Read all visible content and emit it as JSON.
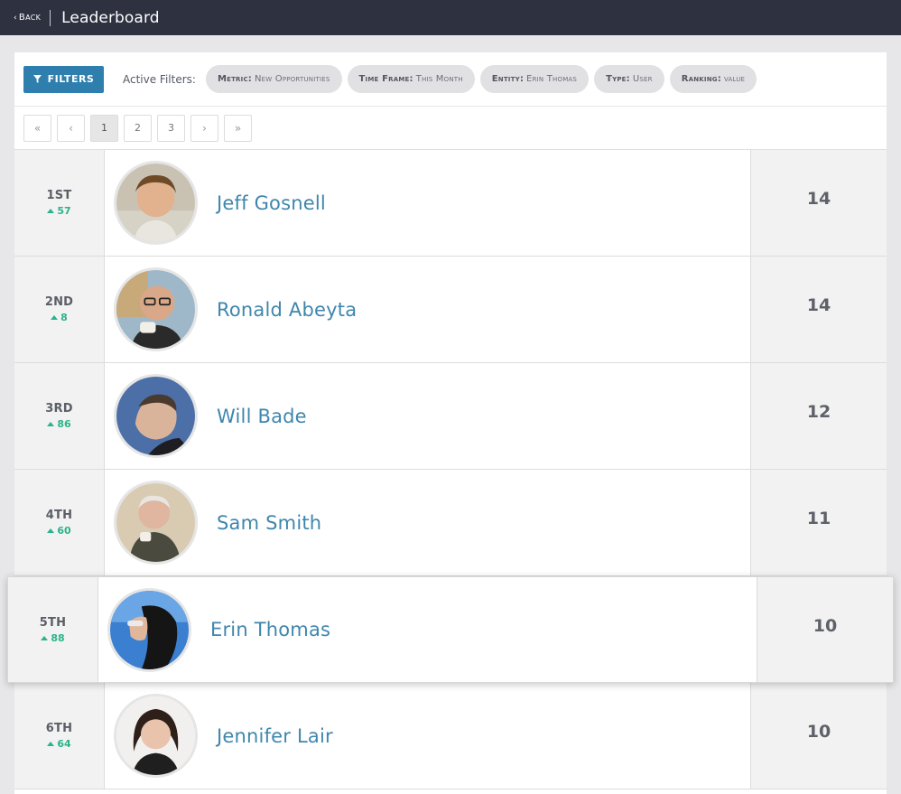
{
  "header": {
    "back_label": "Back",
    "title": "Leaderboard"
  },
  "filters": {
    "button_label": "FILTERS",
    "active_label": "Active Filters:",
    "chips": [
      {
        "key": "Metric:",
        "value": "New Opportunities"
      },
      {
        "key": "Time Frame:",
        "value": "This Month"
      },
      {
        "key": "Entity:",
        "value": "Erin Thomas"
      },
      {
        "key": "Type:",
        "value": "User"
      },
      {
        "key": "Ranking:",
        "value": "value"
      }
    ]
  },
  "pagination": {
    "first": "«",
    "prev": "‹",
    "pages": [
      "1",
      "2",
      "3"
    ],
    "next": "›",
    "last": "»",
    "current": "1"
  },
  "leaderboard": [
    {
      "rank": "1ST",
      "change": "57",
      "name": "Jeff Gosnell",
      "score": "14"
    },
    {
      "rank": "2ND",
      "change": "8",
      "name": "Ronald Abeyta",
      "score": "14"
    },
    {
      "rank": "3RD",
      "change": "86",
      "name": "Will Bade",
      "score": "12"
    },
    {
      "rank": "4TH",
      "change": "60",
      "name": "Sam Smith",
      "score": "11"
    },
    {
      "rank": "5TH",
      "change": "88",
      "name": "Erin Thomas",
      "score": "10"
    },
    {
      "rank": "6TH",
      "change": "64",
      "name": "Jennifer Lair",
      "score": "10"
    }
  ],
  "colors": {
    "topbar": "#2e3140",
    "accent": "#2f7fae",
    "name_link": "#3f86ad",
    "up_change": "#2bb38a"
  }
}
